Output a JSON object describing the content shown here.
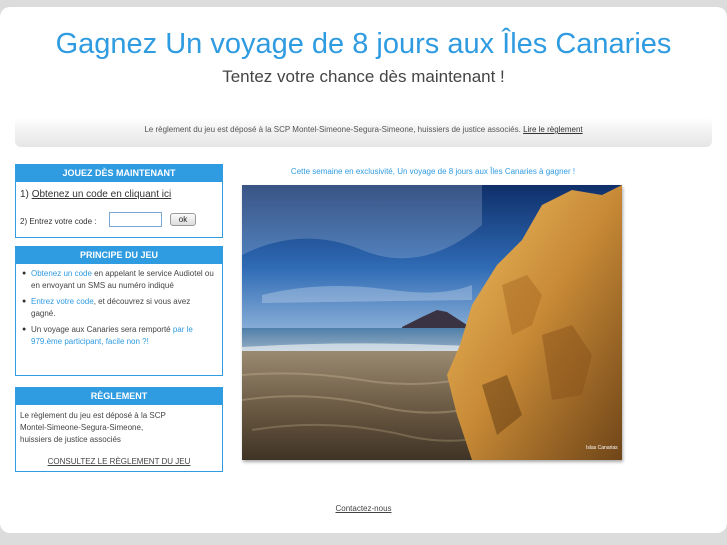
{
  "header": {
    "title": "Gagnez Un voyage de 8 jours aux Îles Canaries",
    "subtitle": "Tentez votre chance dès maintenant !"
  },
  "notice": {
    "text": "Le règlement du jeu est déposé à la SCP Montel-Simeone-Segura-Simeone, huissiers de justice associés.",
    "link": "Lire le règlement"
  },
  "play_box": {
    "title": "Jouez dès maintenant",
    "step1_prefix": "1)",
    "step1_link": "Obtenez un code en cliquant ici",
    "step2_label": "2) Entrez votre code :",
    "code_value": "",
    "ok_label": "ok"
  },
  "principle_box": {
    "title": "Principe du jeu",
    "items": [
      {
        "link": "Obtenez un code",
        "text": " en appelant le service Audiotel ou en envoyant un SMS au numéro indiqué"
      },
      {
        "link": "Entrez votre code",
        "text": ", et découvrez si vous avez gagné."
      },
      {
        "text": "Un voyage aux Canaries sera remporté ",
        "highlight": "par le 979.ème participant, facile non ?!"
      }
    ]
  },
  "rules_box": {
    "title": "Règlement",
    "text_line1": "Le règlement du jeu est déposé à la SCP",
    "text_line2": "Montel-Simeone-Segura-Simeone,",
    "text_line3": "huissiers de justice associés",
    "link": "CONSULTEZ LE RÈGLEMENT DU JEU"
  },
  "promo": {
    "text": "Cette semaine en exclusivité, Un voyage de 8 jours aux Îles Canaries à gagner !",
    "photo_logo": "Islas Canarias"
  },
  "footer": {
    "contact": "Contactez-nous"
  }
}
